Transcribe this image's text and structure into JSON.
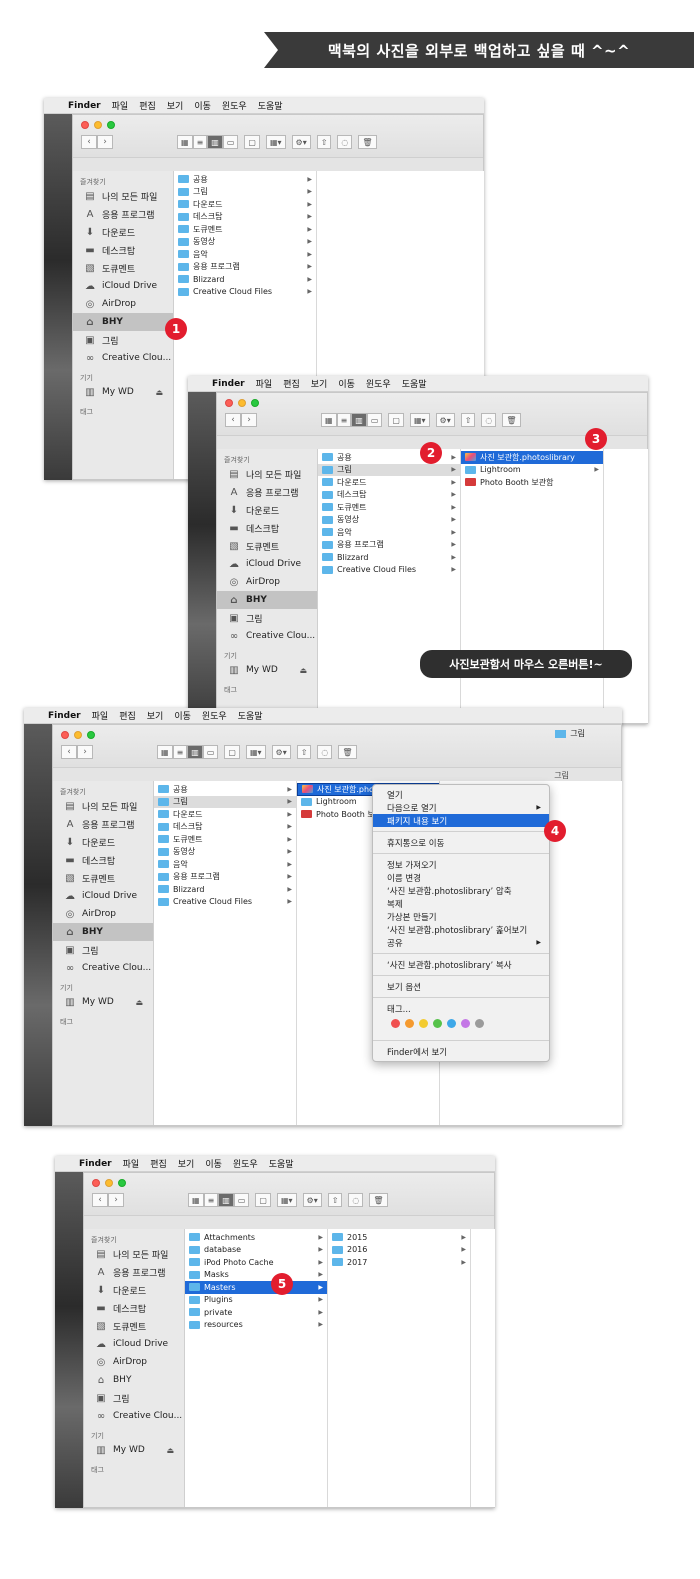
{
  "banner": "맥북의 사진을 외부로 백업하고 싶을 때 ^~^",
  "menubar": [
    "Finder",
    "파일",
    "편집",
    "보기",
    "이동",
    "윈도우",
    "도움말"
  ],
  "sidebar": {
    "favorites_label": "즐겨찾기",
    "favorites": [
      {
        "icon": "recents-icon",
        "label": "나의 모든 파일"
      },
      {
        "icon": "applications-icon",
        "label": "응용 프로그램"
      },
      {
        "icon": "downloads-icon",
        "label": "다운로드"
      },
      {
        "icon": "desktop-icon",
        "label": "데스크탑"
      },
      {
        "icon": "documents-icon",
        "label": "도큐멘트"
      },
      {
        "icon": "icloud-icon",
        "label": "iCloud Drive"
      },
      {
        "icon": "airdrop-icon",
        "label": "AirDrop"
      },
      {
        "icon": "home-icon",
        "label": "BHY"
      },
      {
        "icon": "pictures-icon",
        "label": "그림"
      },
      {
        "icon": "creative-cloud-icon",
        "label": "Creative Clou..."
      }
    ],
    "devices_label": "기기",
    "device": {
      "icon": "drive-icon",
      "label": "My WD",
      "eject": "⏏"
    },
    "tags_label": "태그"
  },
  "home_folders": [
    "공용",
    "그림",
    "다운로드",
    "데스크탑",
    "도큐멘트",
    "동영상",
    "음악",
    "응용 프로그램",
    "Blizzard",
    "Creative Cloud Files"
  ],
  "pictures_items": [
    "사진 보관함.photoslibrary",
    "Lightroom",
    "Photo Booth 보관함"
  ],
  "pictures_items_truncated": [
    "사진 보관함.photosl...",
    "Lightroom",
    "Photo Booth 보..."
  ],
  "library_items": [
    "Attachments",
    "database",
    "iPod Photo Cache",
    "Masks",
    "Masters",
    "Plugins",
    "private",
    "resources"
  ],
  "masters_items": [
    "2015",
    "2016",
    "2017"
  ],
  "callout": "사진보관함서 마우스 오른버튼!~",
  "path_title": "그림",
  "badges": [
    "1",
    "2",
    "3",
    "4",
    "5"
  ],
  "context_menu": {
    "group1": [
      {
        "label": "열기"
      },
      {
        "label": "다음으로 열기",
        "sub": "▶"
      },
      {
        "label": "패키지 내용 보기",
        "selected": true
      }
    ],
    "group2": [
      {
        "label": "휴지통으로 이동"
      }
    ],
    "group3": [
      {
        "label": "정보 가져오기"
      },
      {
        "label": "이름 변경"
      },
      {
        "label": "‘사진 보관함.photoslibrary’ 압축"
      },
      {
        "label": "복제"
      },
      {
        "label": "가상본 만들기"
      },
      {
        "label": "‘사진 보관함.photoslibrary’ 훑어보기"
      },
      {
        "label": "공유",
        "sub": "▶"
      }
    ],
    "group4": [
      {
        "label": "‘사진 보관함.photoslibrary’ 복사"
      }
    ],
    "group5": [
      {
        "label": "보기 옵션"
      }
    ],
    "group6": [
      {
        "label": "태그..."
      }
    ],
    "tag_colors": [
      "#f05050",
      "#f59a2f",
      "#f3cb2f",
      "#56c24a",
      "#3ea8e8",
      "#c477e6",
      "#9b9b9b"
    ],
    "group7": [
      {
        "label": "Finder에서 보기"
      }
    ]
  }
}
